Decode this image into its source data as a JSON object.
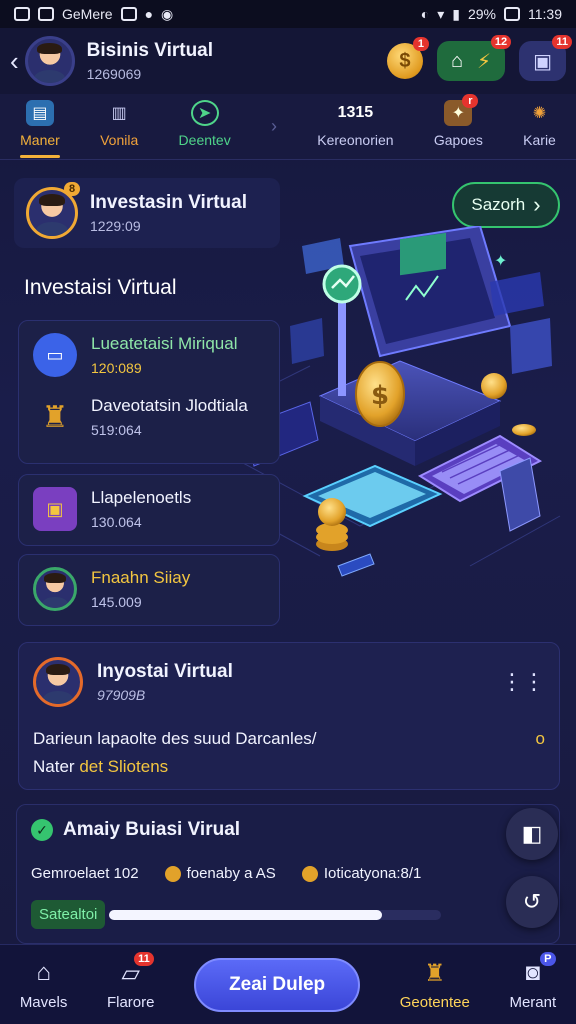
{
  "status_bar": {
    "left_label": "GeMere",
    "battery": "29%",
    "time": "11:39"
  },
  "header": {
    "title": "Bisinis Virtual",
    "subtitle": "1269069",
    "coin_badge": "1",
    "home_badge": "12",
    "wallet_badge": "11"
  },
  "tabs": [
    {
      "label": "Maner",
      "icon": "briefcase-icon"
    },
    {
      "label": "Vonila",
      "icon": "building-icon"
    },
    {
      "label": "Deentev",
      "icon": "leaf-icon"
    },
    {
      "label": "Kereonorien",
      "icon": "counter-icon",
      "icon_text": "1315"
    },
    {
      "label": "Gapoes",
      "icon": "gift-icon",
      "badge": "r"
    },
    {
      "label": "Karie",
      "icon": "gear-icon"
    }
  ],
  "hero_card": {
    "title": "Investasin Virtual",
    "subtitle": "1229:09",
    "badge": "8"
  },
  "search_button": {
    "label": "Sazorh",
    "icon": "chevron-right-icon"
  },
  "section_heading": "Investaisi Virtual",
  "list_items": [
    {
      "title": "Lueatetaisi Miriqual",
      "sub": "120:089"
    },
    {
      "title": "Daveotatsin Jlodtiala",
      "sub": "519:064"
    },
    {
      "title": "Llapelenoetls",
      "sub": "130.064"
    },
    {
      "title": "Fnaahn Siiay",
      "sub": "145.009"
    }
  ],
  "info_card": {
    "title": "Inyostai Virtual",
    "subtitle": "97909B",
    "body_line1": "Darieun lapaolte des suud Darcanles/",
    "body_line2_a": "Nater",
    "body_line2_b": "det Sliotens",
    "indicator": "o"
  },
  "summary_card": {
    "title": "Amaiy Buiasi Virual",
    "stat1": "Gemroelaet 102",
    "stat2": "foenaby a AS",
    "stat3": "Ioticatyona:8/1",
    "progress_label": "Satealtoi",
    "progress": 0.82
  },
  "bottom_nav": [
    {
      "label": "Mavels",
      "icon": "home-icon"
    },
    {
      "label": "Flarore",
      "icon": "chat-icon",
      "badge": "11"
    },
    {
      "label": "Zeai Dulep",
      "icon": "cta"
    },
    {
      "label": "Geotentee",
      "icon": "bag-icon"
    },
    {
      "label": "Merant",
      "icon": "camera-icon",
      "badge": "P"
    }
  ],
  "colors": {
    "accent_gold": "#f3b13a",
    "accent_green": "#35c46f",
    "cta_blue": "#4b56e8",
    "bg": "#181a3e"
  }
}
